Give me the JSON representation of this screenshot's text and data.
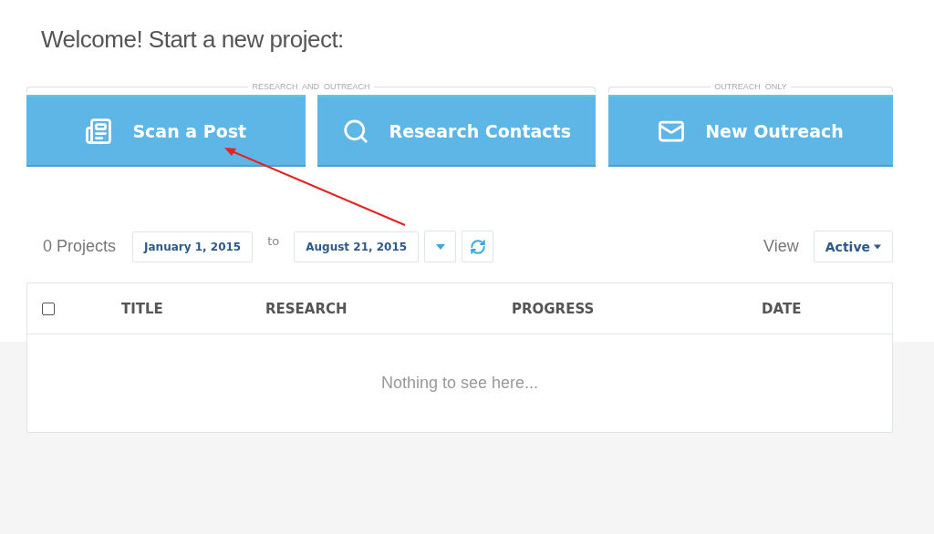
{
  "heading": "Welcome! Start a new project:",
  "groups": [
    {
      "label": "RESEARCH  AND  OUTREACH",
      "buttons": [
        {
          "label": "Scan a Post",
          "kind": "newspaper"
        },
        {
          "label": "Research Contacts",
          "kind": "search"
        }
      ]
    },
    {
      "label": "OUTREACH  ONLY",
      "buttons": [
        {
          "label": "New Outreach",
          "kind": "mail"
        }
      ]
    }
  ],
  "filters": {
    "count": "0 Projects",
    "from": "January 1, 2015",
    "separator": "to",
    "to": "August 21, 2015",
    "view_label": "View",
    "view_value": "Active"
  },
  "table": {
    "select_all": {
      "checked": false
    },
    "columns": [
      "TITLE",
      "RESEARCH",
      "PROGRESS",
      "DATE"
    ],
    "empty_message": "Nothing to see here..."
  }
}
